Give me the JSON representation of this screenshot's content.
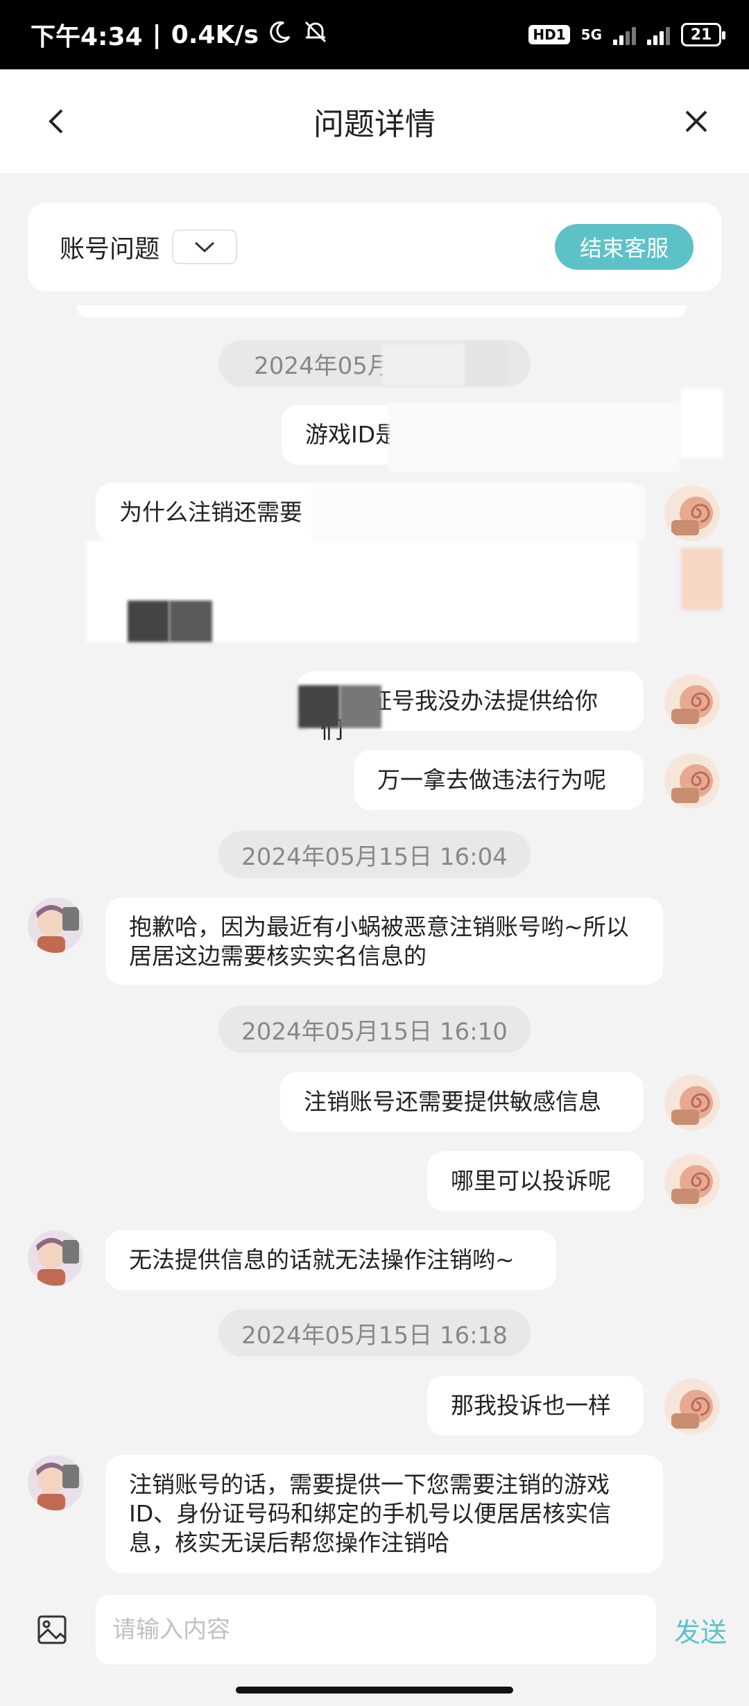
{
  "status_bar": {
    "time": "下午4:34",
    "speed": "0.4K/s",
    "hd": "HD1",
    "network": "5G",
    "battery": "21"
  },
  "header": {
    "title": "问题详情"
  },
  "topic": {
    "label": "账号问题",
    "end_button": "结束客服"
  },
  "messages": {
    "time1": "2024年05月",
    "m1": "游戏ID是",
    "m2": "为什么注销还需要",
    "m3": "证号我没办法提供给你们",
    "m4": "万一拿去做违法行为呢",
    "time2": "2024年05月15日 16:04",
    "a1": "抱歉哈，因为最近有小蜗被恶意注销账号哟~所以居居这边需要核实实名信息的",
    "time3": "2024年05月15日 16:10",
    "m5": "注销账号还需要提供敏感信息",
    "m6": "哪里可以投诉呢",
    "a2": "无法提供信息的话就无法操作注销哟~",
    "time4": "2024年05月15日 16:18",
    "m7": "那我投诉也一样",
    "a3": "注销账号的话，需要提供一下您需要注销的游戏ID、身份证号码和绑定的手机号以便居居核实信息，核实无误后帮您操作注销哈"
  },
  "input": {
    "placeholder": "请输入内容",
    "send": "发送"
  },
  "colors": {
    "accent": "#5cc2c8",
    "background": "#f3f3f4"
  }
}
